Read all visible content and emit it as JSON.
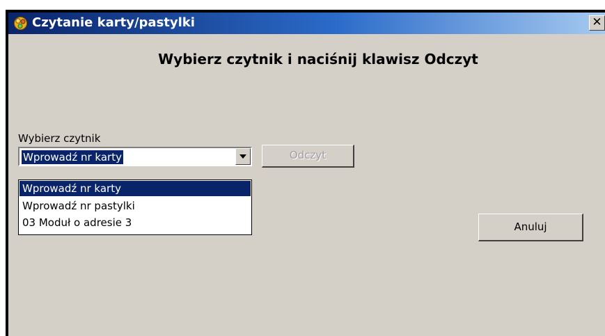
{
  "window": {
    "title": "Czytanie karty/pastylki",
    "close_symbol": "✕",
    "icon": "keys-app-icon",
    "colors": {
      "titlebar_start": "#0a246a",
      "titlebar_end": "#a6caf0",
      "face": "#d4d0c8",
      "selection": "#0a246a"
    }
  },
  "dialog": {
    "heading": "Wybierz czytnik i naciśnij klawisz Odczyt",
    "reader_label": "Wybierz czytnik",
    "reader_select": {
      "selected": "Wprowadź nr karty",
      "expanded": true,
      "options": [
        "Wprowadź nr karty",
        "Wprowadź nr pastylki",
        "03 Moduł o adresie 3"
      ],
      "selected_index": 0
    },
    "read_button": {
      "label": "Odczyt",
      "enabled": false
    },
    "cancel_button": {
      "label": "Anuluj"
    }
  }
}
